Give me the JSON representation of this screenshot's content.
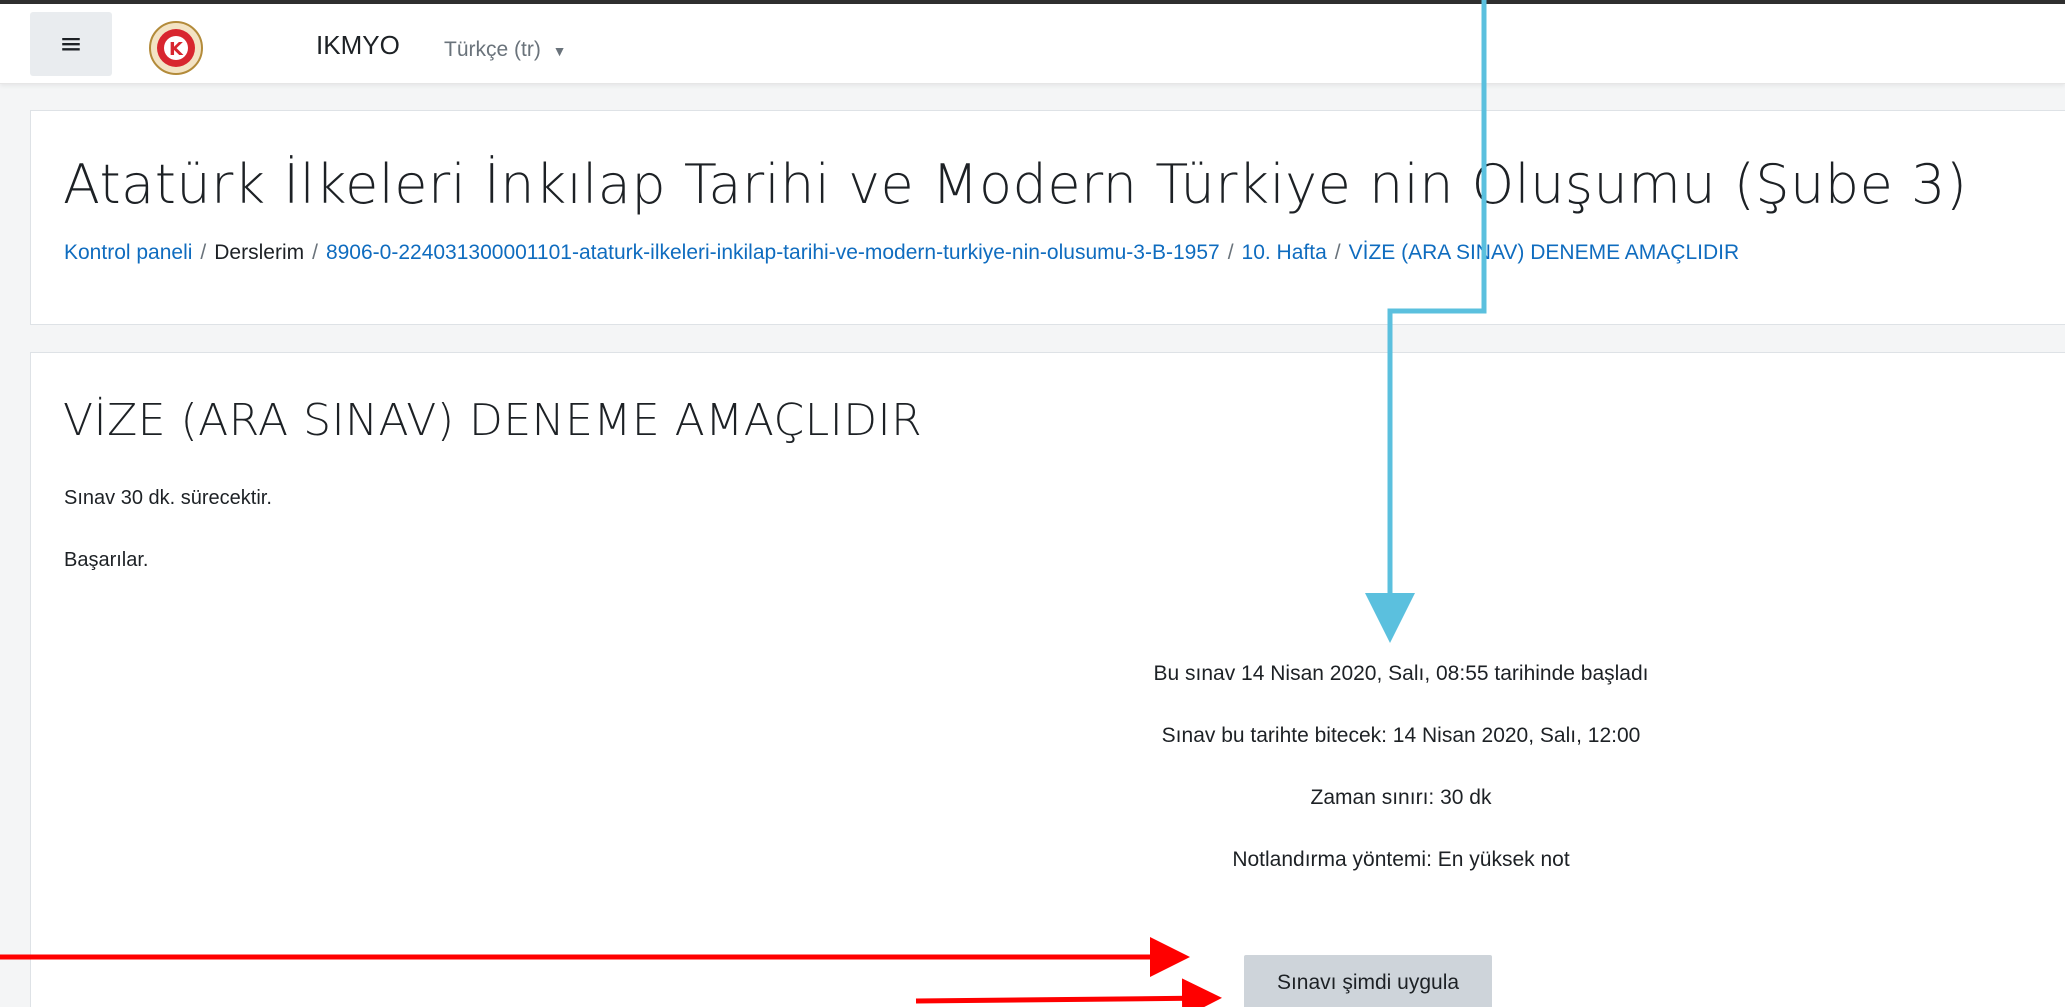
{
  "navbar": {
    "menu_icon": "hamburger-menu-icon",
    "logo": "site-logo-icon",
    "logo_letter": "K",
    "site_name": "IKMYO",
    "language": "Türkçe (tr)"
  },
  "header": {
    "course_title": "Atatürk İlkeleri İnkılap Tarihi ve Modern Türkiye nin Oluşumu (Şube 3)",
    "breadcrumb": [
      {
        "label": "Kontrol paneli",
        "link": true
      },
      {
        "label": "Derslerim",
        "link": false
      },
      {
        "label": "8906-0-224031300001101-ataturk-ilkeleri-inkilap-tarihi-ve-modern-turkiye-nin-olusumu-3-B-1957",
        "link": true
      },
      {
        "label": "10. Hafta",
        "link": true
      },
      {
        "label": "VİZE (ARA SINAV) DENEME AMAÇLIDIR",
        "link": true
      }
    ]
  },
  "quiz": {
    "title": "VİZE (ARA SINAV) DENEME AMAÇLIDIR",
    "intro": [
      "Sınav 30 dk. sürecektir.",
      "Başarılar."
    ],
    "info": [
      "Bu sınav 14 Nisan 2020, Salı, 08:55 tarihinde başladı",
      "Sınav bu tarihte bitecek: 14 Nisan 2020, Salı, 12:00",
      "Zaman sınırı: 30 dk",
      "Notlandırma yöntemi: En yüksek not"
    ],
    "attempt_button": "Sınavı şimdi uygula"
  },
  "annotations": {
    "blue_arrow_color": "#5bc0de",
    "red_arrow_color": "#ff0000"
  },
  "colors": {
    "link": "#0f6cbf",
    "text": "#1d2125",
    "muted": "#6a737b",
    "button_bg": "#ced4da"
  }
}
